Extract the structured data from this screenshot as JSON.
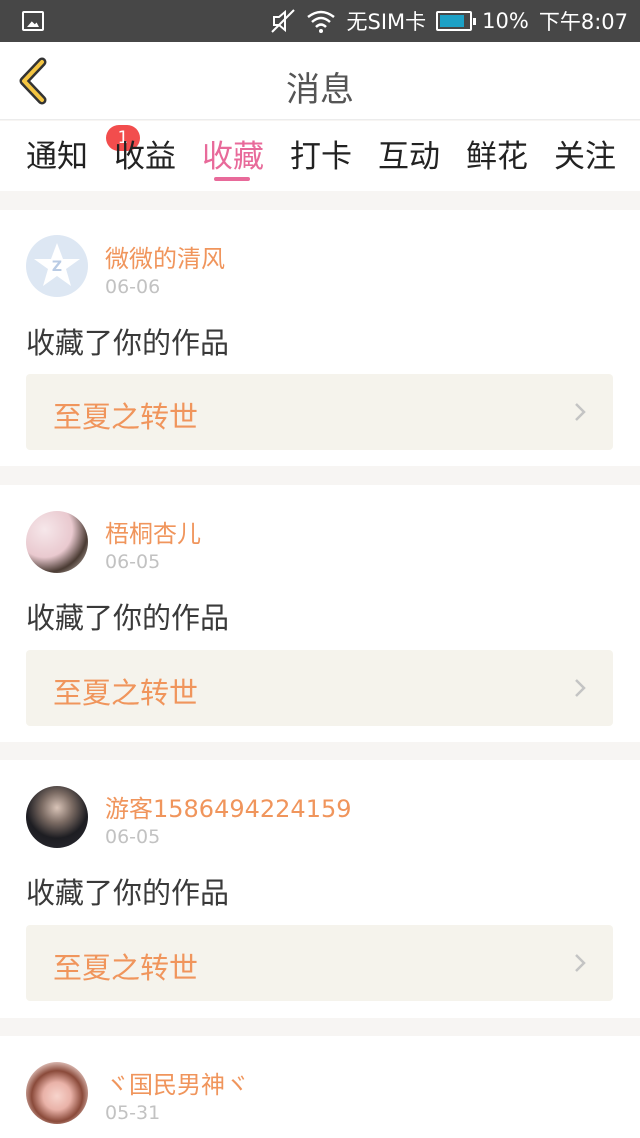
{
  "status": {
    "sim": "无SIM卡",
    "battery": "10%",
    "time": "下午8:07"
  },
  "header": {
    "title": "消息"
  },
  "tabs": [
    {
      "label": "通知",
      "badge": "1"
    },
    {
      "label": "收益"
    },
    {
      "label": "收藏"
    },
    {
      "label": "打卡"
    },
    {
      "label": "互动"
    },
    {
      "label": "鲜花"
    },
    {
      "label": "关注"
    }
  ],
  "active_tab": "收藏",
  "notifications": [
    {
      "user": "微微的清风",
      "date": "06-06",
      "action": "收藏了你的作品",
      "work": "至夏之转世",
      "avatar": "default-star-avatar"
    },
    {
      "user": "梧桐杏儿",
      "date": "06-05",
      "action": "收藏了你的作品",
      "work": "至夏之转世",
      "avatar": "photo-avatar"
    },
    {
      "user": "游客1586494224159",
      "date": "06-05",
      "action": "收藏了你的作品",
      "work": "至夏之转世",
      "avatar": "photo-avatar"
    },
    {
      "user": "ヾ国民男神ヾ",
      "date": "05-31",
      "avatar": "photo-avatar"
    }
  ],
  "colors": {
    "accent_pink": "#e86a9a",
    "username_orange": "#f0955c",
    "badge_red": "#f24d4d",
    "status_bar": "#474747"
  }
}
